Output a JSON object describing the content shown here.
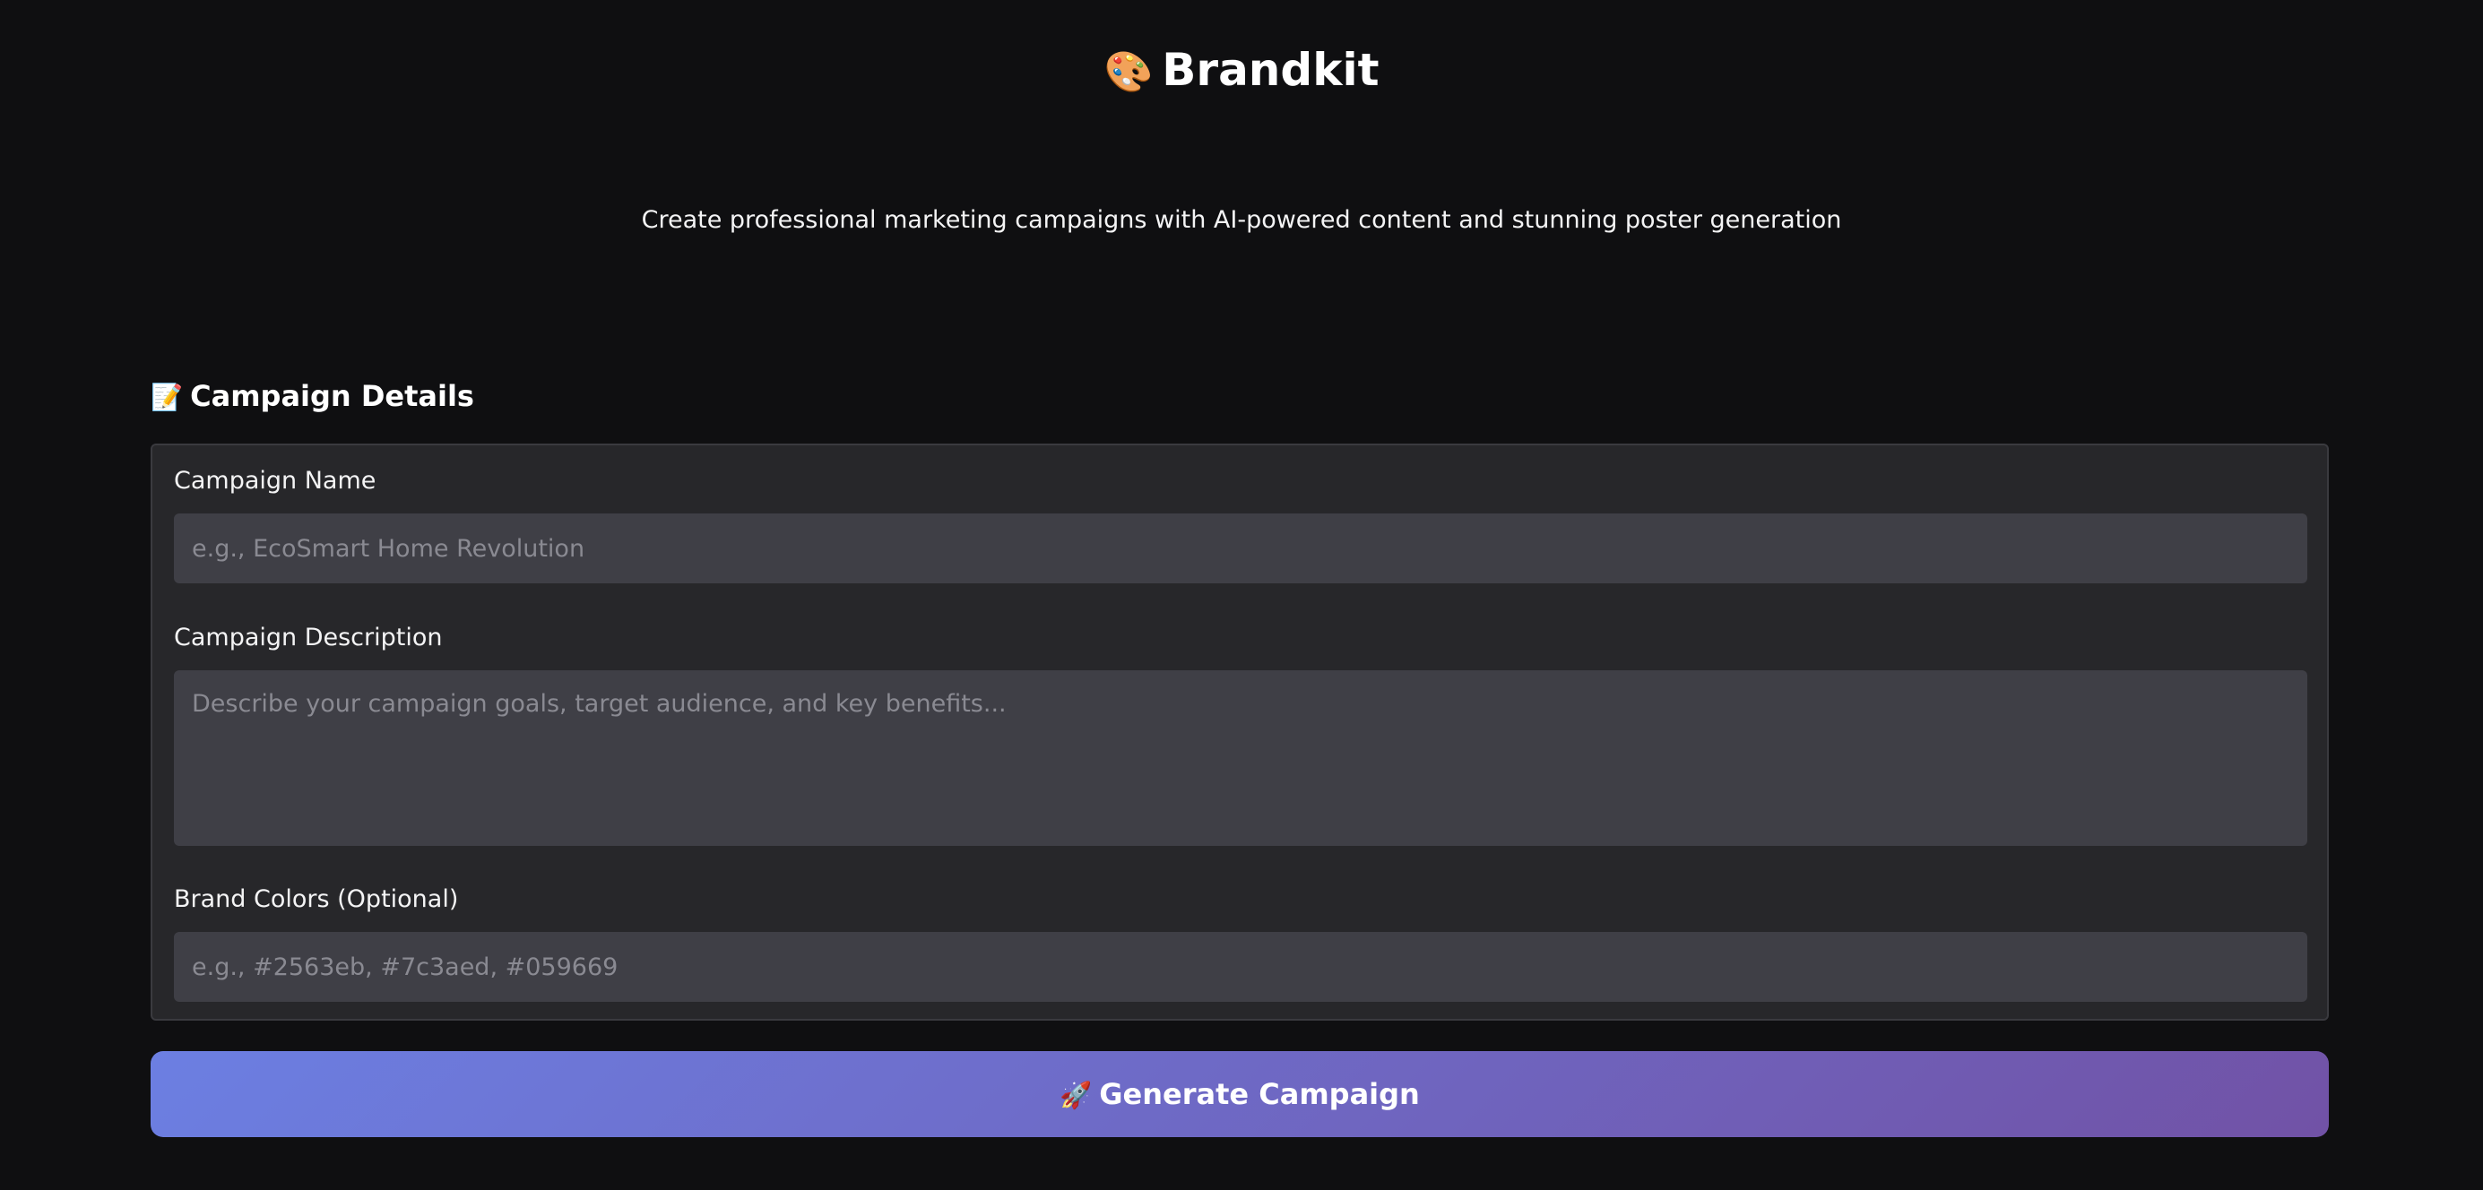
{
  "header": {
    "icon": "palette-icon",
    "icon_glyph": "🎨",
    "title": "Brandkit",
    "subtitle": "Create professional marketing campaigns with AI-powered content and stunning poster generation"
  },
  "section": {
    "icon": "memo-icon",
    "icon_glyph": "📝",
    "title": "Campaign Details"
  },
  "form": {
    "campaign_name": {
      "label": "Campaign Name",
      "value": "",
      "placeholder": "e.g., EcoSmart Home Revolution"
    },
    "campaign_description": {
      "label": "Campaign Description",
      "value": "",
      "placeholder": "Describe your campaign goals, target audience, and key benefits..."
    },
    "brand_colors": {
      "label": "Brand Colors (Optional)",
      "value": "",
      "placeholder": "e.g., #2563eb, #7c3aed, #059669"
    }
  },
  "generate_button": {
    "icon": "rocket-icon",
    "icon_glyph": "🚀",
    "label": "Generate Campaign"
  },
  "colors": {
    "background": "#0f0f11",
    "card": "#27272a",
    "input": "#3f3f46",
    "button_gradient_start": "#6c7fe2",
    "button_gradient_end": "#7152a6"
  }
}
